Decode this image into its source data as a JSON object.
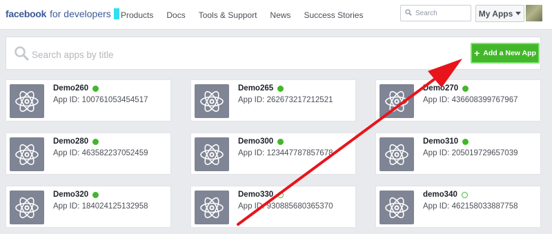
{
  "brand": {
    "name": "facebook",
    "suffix": "for developers"
  },
  "nav": {
    "items": [
      "Products",
      "Docs",
      "Tools & Support",
      "News",
      "Success Stories"
    ]
  },
  "search": {
    "placeholder": "Search"
  },
  "my_apps": {
    "label": "My Apps"
  },
  "app_search": {
    "placeholder": "Search apps by title"
  },
  "add_app": {
    "label": "Add a New App"
  },
  "status_colors": {
    "live": "#42b72a",
    "development": "#42b72a"
  },
  "apps": [
    {
      "name": "Demo260",
      "app_id_label": "App ID:",
      "app_id": "100761053454517",
      "status": "live"
    },
    {
      "name": "Demo265",
      "app_id_label": "App ID:",
      "app_id": "262673217212521",
      "status": "live"
    },
    {
      "name": "Demo270",
      "app_id_label": "App ID:",
      "app_id": "436608399767967",
      "status": "live"
    },
    {
      "name": "Demo280",
      "app_id_label": "App ID:",
      "app_id": "463582237052459",
      "status": "live"
    },
    {
      "name": "Demo300",
      "app_id_label": "App ID:",
      "app_id": "123447787857678",
      "status": "live"
    },
    {
      "name": "Demo310",
      "app_id_label": "App ID:",
      "app_id": "205019729657039",
      "status": "live"
    },
    {
      "name": "Demo320",
      "app_id_label": "App ID:",
      "app_id": "184024125132958",
      "status": "live"
    },
    {
      "name": "Demo330",
      "app_id_label": "App ID:",
      "app_id": "930885680365370",
      "status": "development"
    },
    {
      "name": "demo340",
      "app_id_label": "App ID:",
      "app_id": "462158033887758",
      "status": "development"
    }
  ],
  "annotation": {
    "arrow_color": "#e8141b"
  }
}
